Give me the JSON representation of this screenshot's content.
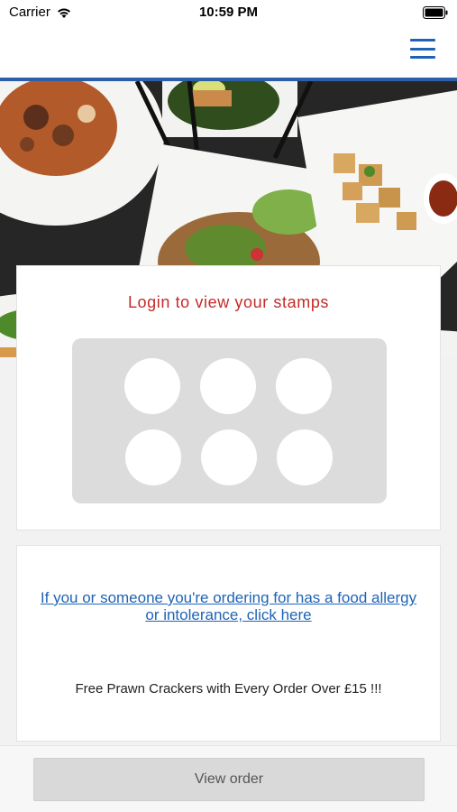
{
  "status_bar": {
    "carrier": "Carrier",
    "time": "10:59 PM",
    "icons": [
      "wifi-icon",
      "battery-icon"
    ]
  },
  "header": {
    "menu_icon": "hamburger-menu-icon",
    "accent_color": "#1f63b5",
    "rule_color": "#2d5fa8"
  },
  "hero": {
    "image": "food-photo"
  },
  "stamp_card": {
    "title": "Login to view your stamps",
    "title_color": "#c42a2a",
    "stamp_count": 6,
    "stamps_collected": 0
  },
  "info_card": {
    "allergy_link": "If you or someone you're ordering for has a food allergy or intolerance, click here",
    "promo": "Free Prawn Crackers with Every Order Over £15 !!!"
  },
  "bottom_bar": {
    "view_order_label": "View order"
  }
}
